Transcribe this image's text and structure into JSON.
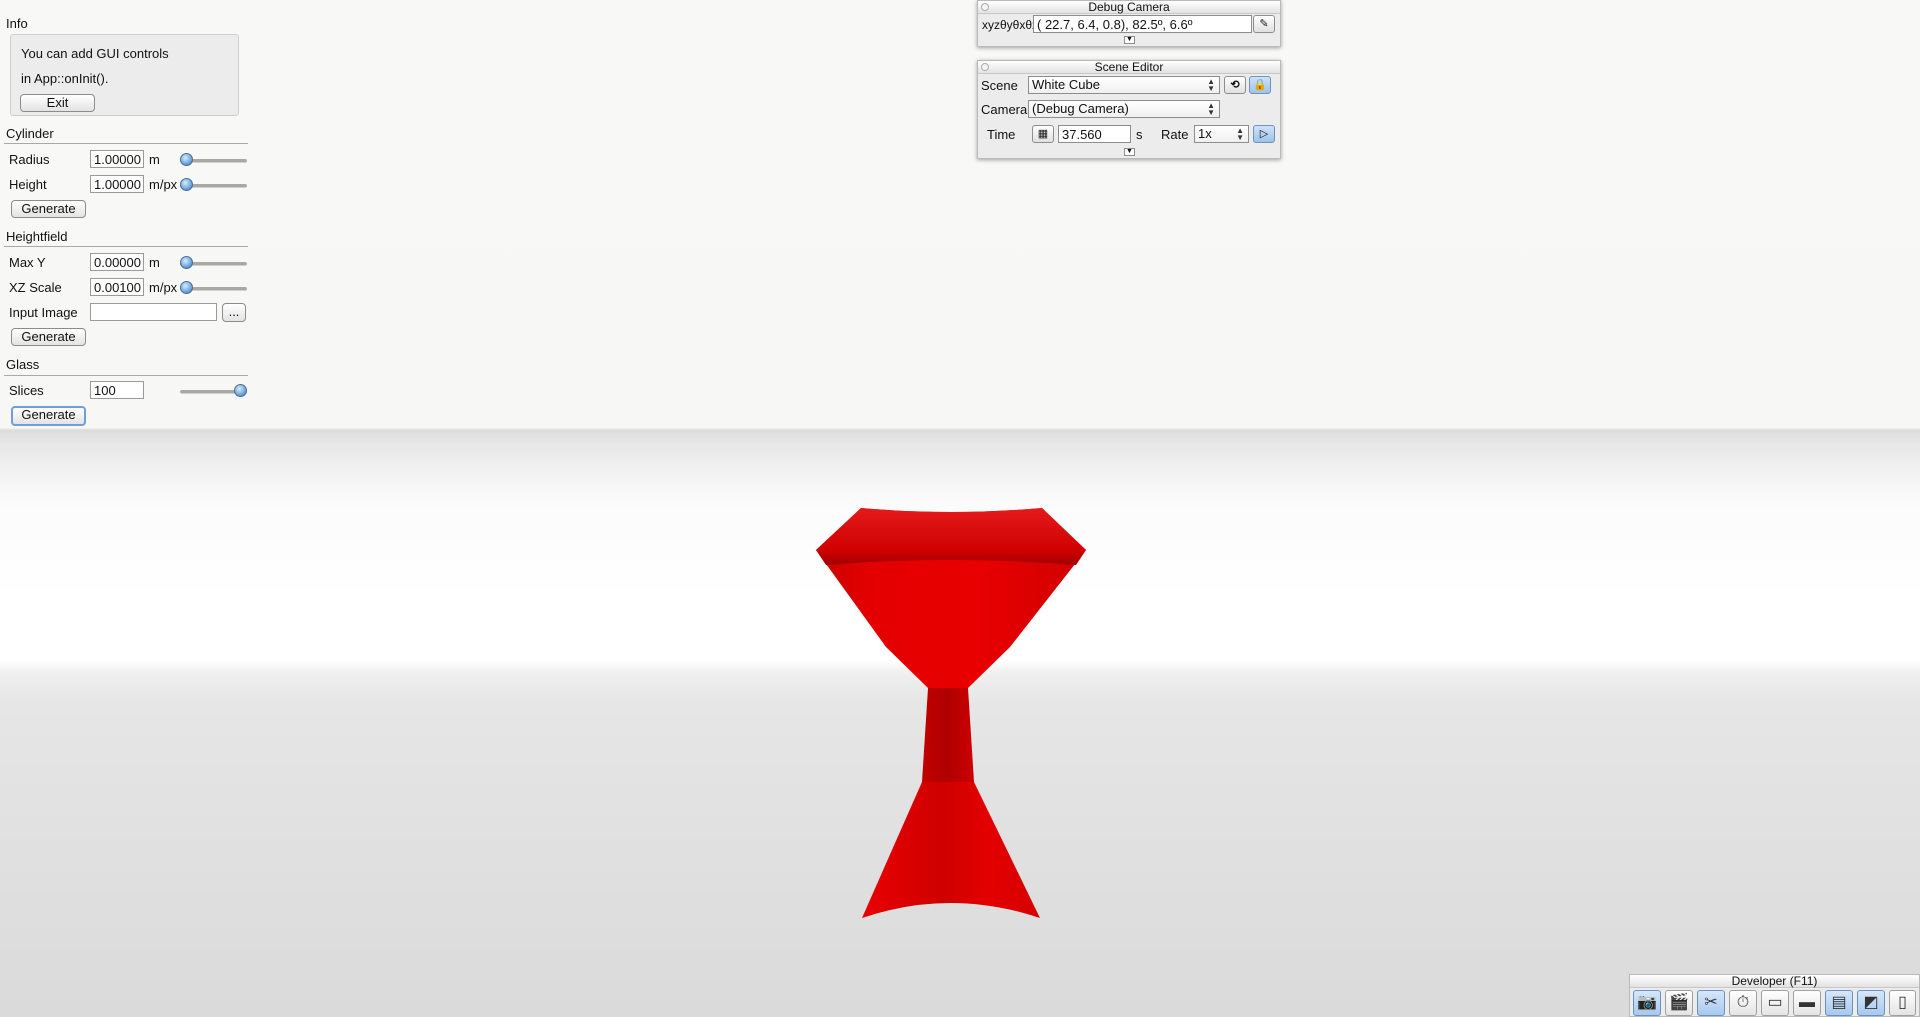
{
  "info": {
    "title": "Info",
    "line1": "You can add GUI controls",
    "line2": "in App::onInit().",
    "exit_label": "Exit"
  },
  "cylinder": {
    "title": "Cylinder",
    "radius_label": "Radius",
    "radius_value": "1.00000",
    "radius_unit": "m",
    "radius_slider_fraction": 0.0,
    "height_label": "Height",
    "height_value": "1.00000",
    "height_unit": "m/px",
    "height_slider_fraction": 0.0,
    "generate_label": "Generate"
  },
  "heightfield": {
    "title": "Heightfield",
    "maxy_label": "Max Y",
    "maxy_value": "0.00000",
    "maxy_unit": "m",
    "maxy_slider_fraction": 0.0,
    "xzscale_label": "XZ Scale",
    "xzscale_value": "0.00100",
    "xzscale_unit": "m/px",
    "xzscale_slider_fraction": 0.0,
    "input_image_label": "Input Image",
    "input_image_value": "",
    "browse_label": "...",
    "generate_label": "Generate"
  },
  "glass": {
    "title": "Glass",
    "slices_label": "Slices",
    "slices_value": "100",
    "slices_slider_fraction": 1.0,
    "generate_label": "Generate"
  },
  "debug_camera": {
    "title": "Debug Camera",
    "coord_label": "xyzθyθxθz",
    "coord_value": "( 22.7,   6.4,   0.8),  82.5º,   6.6º"
  },
  "scene_editor": {
    "title": "Scene Editor",
    "scene_label": "Scene",
    "scene_value": "White Cube",
    "camera_label": "Camera",
    "camera_value": "(Debug Camera)",
    "time_label": "Time",
    "time_value": "37.560",
    "time_unit": "s",
    "rate_label": "Rate",
    "rate_value": "1x"
  },
  "developer": {
    "title": "Developer (F11)"
  },
  "colors": {
    "object_red": "#e00000",
    "accent_blue": "#6f9fd8"
  }
}
